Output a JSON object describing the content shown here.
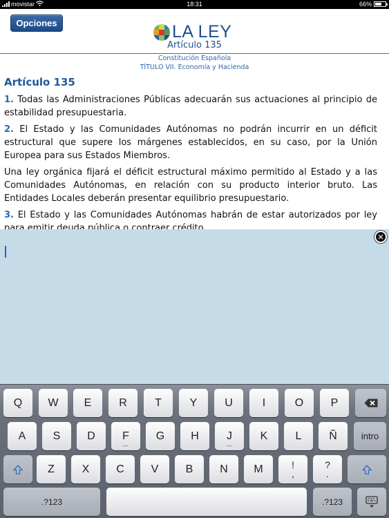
{
  "status_bar": {
    "carrier": "movistar",
    "time": "18:31",
    "battery": "66%",
    "battery_level": 0.66,
    "signal_bars": 4
  },
  "header": {
    "options_button": "Opciones",
    "logo_text": "LA LEY",
    "article_label": "Artículo 135",
    "subtitle_1": "Constitución Española",
    "subtitle_2": "TÍTULO VII. Economía y Hacienda"
  },
  "content": {
    "title": "Artículo 135",
    "paragraphs": [
      {
        "num": "1.",
        "text": " Todas las Administraciones Públicas adecuarán sus actuaciones al principio de estabilidad presupuestaria."
      },
      {
        "num": "2.",
        "text": " El Estado y las Comunidades Autónomas no podrán incurrir en un déficit estructural que supere los márgenes establecidos, en su caso, por la Unión Europea para sus Estados Miembros."
      },
      {
        "num": "",
        "text": "Una ley orgánica fijará el déficit estructural máximo permitido al Estado y a las Comunidades Autónomas, en relación con su producto interior bruto. Las Entidades Locales deberán presentar equilibrio presupuestario."
      },
      {
        "num": "3.",
        "text": " El Estado y las Comunidades Autónomas habrán de estar autorizados por ley para emitir deuda pública o contraer crédito."
      }
    ]
  },
  "note_panel": {
    "close_icon": "close-icon",
    "text": ""
  },
  "keyboard": {
    "row1": [
      "Q",
      "W",
      "E",
      "R",
      "T",
      "Y",
      "U",
      "I",
      "O",
      "P"
    ],
    "row2": [
      "A",
      "S",
      "D",
      "F",
      "G",
      "H",
      "J",
      "K",
      "L",
      "Ñ"
    ],
    "row3": [
      "Z",
      "X",
      "C",
      "V",
      "B",
      "N",
      "M"
    ],
    "return_label": "intro",
    "numbers_label": ".?123",
    "punct1": {
      "top": "!",
      "bottom": ","
    },
    "punct2": {
      "top": "?",
      "bottom": "."
    },
    "icons": {
      "backspace": "backspace-icon",
      "shift": "shift-icon",
      "hide_keyboard": "keyboard-hide-icon"
    }
  },
  "colors": {
    "accent": "#1e4f8f",
    "note_bg": "#c6dbe8"
  }
}
